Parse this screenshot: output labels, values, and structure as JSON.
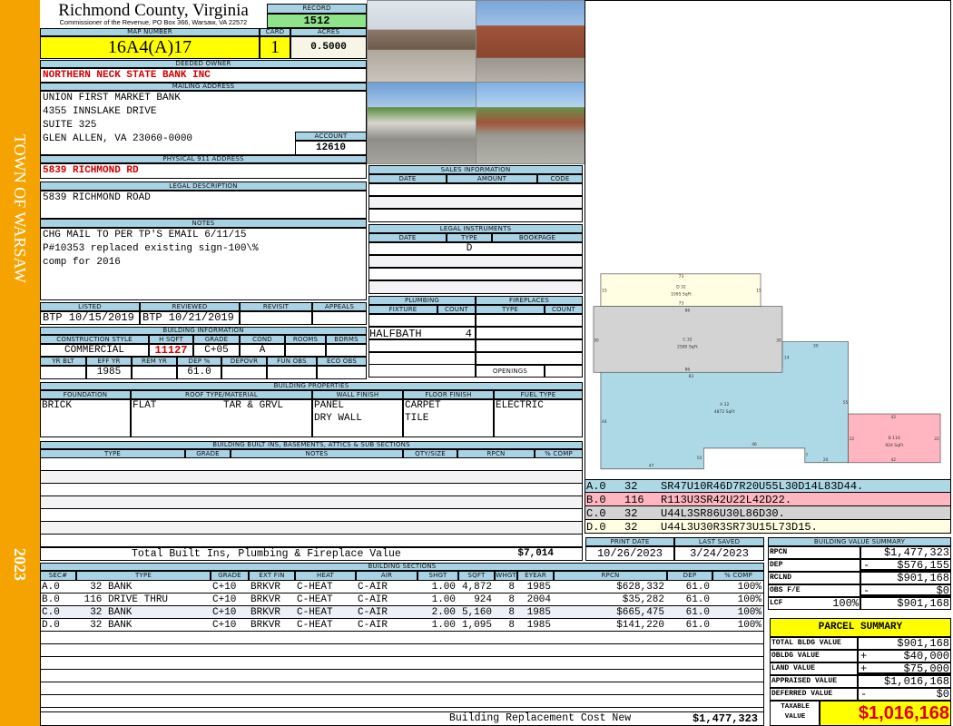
{
  "sidebar": {
    "town": "TOWN OF WARSAW",
    "year": "2023"
  },
  "header": {
    "county": "Richmond County, Virginia",
    "office": "Commissioner of the Revenue, PO Box 366, Warsaw, VA 22572",
    "record_label": "RECORD",
    "record": "1512"
  },
  "parcel": {
    "map_label": "MAP NUMBER",
    "map_number": "16A4(A)17",
    "card_label": "CARD",
    "card": "1",
    "acres_label": "ACRES",
    "acres": "0.5000"
  },
  "owner": {
    "label": "DEEDED OWNER",
    "name": "NORTHERN NECK STATE BANK INC"
  },
  "mailing": {
    "label": "MAILING ADDRESS",
    "lines": [
      "UNION FIRST MARKET BANK",
      "4355 INNSLAKE DRIVE",
      "SUITE 325",
      "GLEN ALLEN, VA 23060-0000"
    ],
    "account_label": "ACCOUNT",
    "account": "12610"
  },
  "physical": {
    "label": "PHYSICAL 911 ADDRESS",
    "value": "5839 RICHMOND RD"
  },
  "legal": {
    "label": "LEGAL DESCRIPTION",
    "value": "5839 RICHMOND ROAD"
  },
  "notes": {
    "label": "NOTES",
    "lines": [
      "CHG MAIL TO PER TP'S EMAIL 6/11/15",
      "P#10353 replaced existing sign-100\\%",
      "comp for 2016"
    ]
  },
  "review": {
    "headers": [
      "LISTED",
      "REVIEWED",
      "REVISIT",
      "APPEALS"
    ],
    "values": [
      "BTP 10/15/2019",
      "BTP 10/21/2019",
      "",
      ""
    ]
  },
  "building_info": {
    "label": "BUILDING INFORMATION",
    "row1_headers": [
      "CONSTRUCTION STYLE",
      "H SQFT",
      "GRADE",
      "COND",
      "ROOMS",
      "BDRMS"
    ],
    "row1_values": [
      "COMMERCIAL",
      "11127",
      "C+05",
      "A",
      "",
      ""
    ],
    "row2_headers": [
      "YR BLT",
      "EFF YR",
      "REM YR",
      "DEP %",
      "DEPOVR",
      "FUN OBS",
      "ECO OBS"
    ],
    "row2_values": [
      "",
      "1985",
      "",
      "61.0",
      "",
      "",
      ""
    ]
  },
  "sales": {
    "label": "SALES INFORMATION",
    "headers": [
      "DATE",
      "AMOUNT",
      "CODE"
    ]
  },
  "instruments": {
    "label": "LEGAL INSTRUMENTS",
    "headers": [
      "DATE",
      "TYPE",
      "BOOKPAGE"
    ],
    "type": "D"
  },
  "plumbing": {
    "label": "PLUMBING",
    "headers": [
      "FIXTURE",
      "COUNT"
    ],
    "fixture": "HALFBATH",
    "count": "4"
  },
  "fireplaces": {
    "label": "FIREPLACES",
    "headers": [
      "TYPE",
      "COUNT"
    ],
    "openings_label": "OPENINGS"
  },
  "properties": {
    "label": "BUILDING PROPERTIES",
    "headers": [
      "FOUNDATION",
      "ROOF TYPE/MATERIAL",
      "WALL FINISH",
      "FLOOR FINISH",
      "FUEL TYPE"
    ],
    "foundation": "BRICK",
    "roof_type": "FLAT",
    "roof_material": "TAR & GRVL",
    "wall": [
      "PANEL",
      "DRY WALL"
    ],
    "floor": [
      "CARPET",
      "TILE"
    ],
    "fuel": "ELECTRIC"
  },
  "builtins": {
    "label": "BUILDING BUILT INS, BASEMENTS, ATTICS & SUB SECTIONS",
    "headers": [
      "TYPE",
      "GRADE",
      "NOTES",
      "QTY/SIZE",
      "RPCN",
      "% COMP"
    ],
    "total_label": "Total Built Ins, Plumbing & Fireplace Value",
    "total": "$7,014"
  },
  "sections": {
    "label": "BUILDING SECTIONS",
    "headers": [
      "SEC#",
      "TYPE",
      "GRADE",
      "EXT FIN",
      "HEAT",
      "AIR",
      "SHGT",
      "SQFT",
      "WHGT",
      "EYEAR",
      "RPCN",
      "DEP",
      "% COMP"
    ],
    "rows": [
      [
        "A.0",
        "  32 BANK",
        "C+10",
        "BRKVR",
        "C-HEAT",
        "C-AIR",
        "1.00",
        "4,872",
        "8",
        "1985",
        "$628,332",
        "61.0",
        "100%"
      ],
      [
        "B.0",
        " 116 DRIVE THRU",
        "C+10",
        "BRKVR",
        "C-HEAT",
        "C-AIR",
        "1.00",
        "924",
        "8",
        "2004",
        "$35,282",
        "61.0",
        "100%"
      ],
      [
        "C.0",
        "  32 BANK",
        "C+10",
        "BRKVR",
        "C-HEAT",
        "C-AIR",
        "2.00",
        "5,160",
        "8",
        "1985",
        "$665,475",
        "61.0",
        "100%"
      ],
      [
        "D.0",
        "  32 BANK",
        "C+10",
        "BRKVR",
        "C-HEAT",
        "C-AIR",
        "1.00",
        "1,095",
        "8",
        "1985",
        "$141,220",
        "61.0",
        "100%"
      ]
    ],
    "cost_label": "Building Replacement Cost New",
    "cost": "$1,477,323"
  },
  "sketch": {
    "areas": [
      {
        "label": "D 32",
        "sqft": "1095 SqFt"
      },
      {
        "label": "C 32",
        "sqft": "2580 SqFt"
      },
      {
        "label": "A 32",
        "sqft": "4872 SqFt"
      },
      {
        "label": "B 116",
        "sqft": "924 SqFt"
      }
    ],
    "dims": [
      "73",
      "15",
      "15",
      "73",
      "86",
      "30",
      "30",
      "86",
      "83",
      "44",
      "30",
      "14",
      "55",
      "46",
      "10",
      "47",
      "7",
      "20",
      "42",
      "22",
      "22",
      "42"
    ],
    "legend": [
      {
        "sec": "A.0",
        "code": "32",
        "vectors": "SR47U10R46D7R20U55L30D14L83D44."
      },
      {
        "sec": "B.0",
        "code": "116",
        "vectors": "R113U3SR42U22L42D22."
      },
      {
        "sec": "C.0",
        "code": "32",
        "vectors": "U44L3SR86U30L86D30."
      },
      {
        "sec": "D.0",
        "code": "32",
        "vectors": "U44L3U30R3SR73U15L73D15."
      }
    ],
    "colors": {
      "A": "#add8e6",
      "B": "#ffb6c1",
      "C": "#d3d3d3",
      "D": "#fffde2"
    }
  },
  "dates": {
    "print_label": "PRINT DATE",
    "print": "10/26/2023",
    "saved_label": "LAST SAVED",
    "saved": "3/24/2023"
  },
  "value_summary": {
    "label": "BUILDING VALUE SUMMARY",
    "rows": [
      {
        "label": "RPCN",
        "sign": "",
        "value": "$1,477,323"
      },
      {
        "label": "DEP",
        "sign": "-",
        "value": "$576,155"
      },
      {
        "label": "RCLND",
        "sign": "",
        "value": "$901,168"
      },
      {
        "label": "OBS F/E",
        "sign": "-",
        "value": "$0"
      },
      {
        "label": "LCF",
        "pct": "100%",
        "sign": "",
        "value": "$901,168"
      }
    ]
  },
  "parcel_summary": {
    "title": "PARCEL SUMMARY",
    "rows": [
      {
        "label": "TOTAL BLDG VALUE",
        "sign": "",
        "value": "$901,168"
      },
      {
        "label": "OBLDG VALUE",
        "sign": "+",
        "value": "$40,000"
      },
      {
        "label": "LAND VALUE",
        "sign": "+",
        "value": "$75,000"
      },
      {
        "label": "APPRAISED VALUE",
        "sign": "",
        "value": "$1,016,168"
      },
      {
        "label": "DEFERRED VALUE",
        "sign": "-",
        "value": "$0"
      }
    ],
    "taxable_label": "TAXABLE VALUE",
    "taxable": "$1,016,168"
  }
}
